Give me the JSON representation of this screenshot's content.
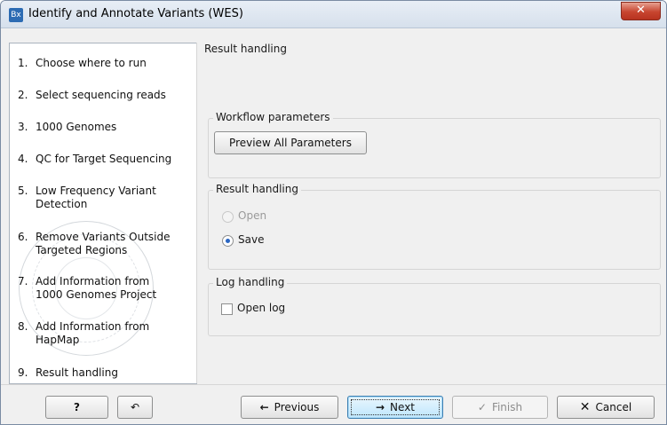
{
  "window": {
    "icon_text": "Bx",
    "title": "Identify and Annotate Variants (WES)",
    "close_glyph": "✕"
  },
  "sidebar": {
    "steps": [
      {
        "num": "1.",
        "label": "Choose where to run"
      },
      {
        "num": "2.",
        "label": "Select sequencing reads"
      },
      {
        "num": "3.",
        "label": "1000 Genomes"
      },
      {
        "num": "4.",
        "label": "QC for Target Sequencing"
      },
      {
        "num": "5.",
        "label": "Low Frequency Variant Detection"
      },
      {
        "num": "6.",
        "label": "Remove Variants Outside Targeted Regions"
      },
      {
        "num": "7.",
        "label": "Add Information from 1000 Genomes Project"
      },
      {
        "num": "8.",
        "label": "Add Information from HapMap"
      },
      {
        "num": "9.",
        "label": "Result handling"
      }
    ]
  },
  "main": {
    "heading": "Result handling",
    "workflow_params": {
      "title": "Workflow parameters",
      "preview_button": "Preview All Parameters"
    },
    "result_handling": {
      "title": "Result handling",
      "open_label": "Open",
      "save_label": "Save"
    },
    "log_handling": {
      "title": "Log handling",
      "open_log_label": "Open log"
    }
  },
  "footer": {
    "help_label": "?",
    "reset_icon": "↶",
    "previous_icon": "←",
    "previous_label": "Previous",
    "next_icon": "→",
    "next_label": "Next",
    "finish_icon": "✓",
    "finish_label": "Finish",
    "cancel_icon": "✕",
    "cancel_label": "Cancel"
  },
  "colors": {
    "accent": "#2b66c2",
    "close": "#c7452f",
    "focus": "#3c7fb1"
  }
}
